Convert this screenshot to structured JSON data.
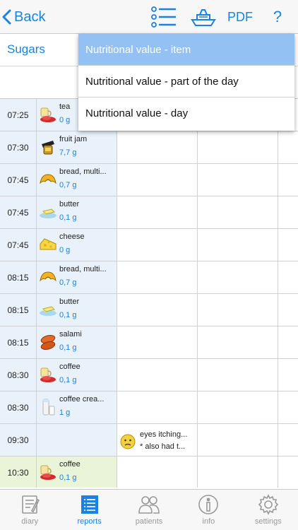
{
  "nav": {
    "back_label": "Back",
    "pdf_label": "PDF",
    "help_label": "?"
  },
  "page_title": "Sugars",
  "dropdown": [
    {
      "label": "Nutritional value - item",
      "selected": true
    },
    {
      "label": "Nutritional value - part of the day",
      "selected": false
    },
    {
      "label": "Nutritional value - day",
      "selected": false
    }
  ],
  "rows": [
    {
      "time": "07:25",
      "name": "tea",
      "value": "0 g",
      "icon": "tea-cup-icon"
    },
    {
      "time": "07:30",
      "name": "fruit jam",
      "value": "7,7 g",
      "icon": "jam-jar-icon"
    },
    {
      "time": "07:45",
      "name": "bread, multi...",
      "value": "0,7 g",
      "icon": "croissant-icon"
    },
    {
      "time": "07:45",
      "name": "butter",
      "value": "0,1 g",
      "icon": "butter-icon"
    },
    {
      "time": "07:45",
      "name": "cheese",
      "value": "0 g",
      "icon": "cheese-icon"
    },
    {
      "time": "08:15",
      "name": "bread, multi...",
      "value": "0,7 g",
      "icon": "croissant-icon"
    },
    {
      "time": "08:15",
      "name": "butter",
      "value": "0,1 g",
      "icon": "butter-icon"
    },
    {
      "time": "08:15",
      "name": "salami",
      "value": "0,1 g",
      "icon": "salami-icon"
    },
    {
      "time": "08:30",
      "name": "coffee",
      "value": "0,1 g",
      "icon": "coffee-cup-icon"
    },
    {
      "time": "08:30",
      "name": "coffee crea...",
      "value": "1 g",
      "icon": "milk-bottle-icon"
    },
    {
      "time": "09:30",
      "name": "",
      "value": "",
      "icon": "",
      "note_line1": "eyes itching...",
      "note_line2": "* also had t..."
    },
    {
      "time": "10:30",
      "name": "coffee",
      "value": "0,1 g",
      "icon": "coffee-cup-icon",
      "highlight": "green"
    }
  ],
  "tabs": [
    {
      "label": "diary",
      "icon": "diary-icon",
      "active": false
    },
    {
      "label": "reports",
      "icon": "reports-icon",
      "active": true
    },
    {
      "label": "patients",
      "icon": "patients-icon",
      "active": false
    },
    {
      "label": "info",
      "icon": "info-icon",
      "active": false
    },
    {
      "label": "settings",
      "icon": "settings-icon",
      "active": false
    }
  ],
  "colors": {
    "accent": "#1a82e2",
    "row_blue": "#e9f2fb",
    "row_green": "#eaf4d8",
    "dropdown_selected": "#93c1f4"
  }
}
